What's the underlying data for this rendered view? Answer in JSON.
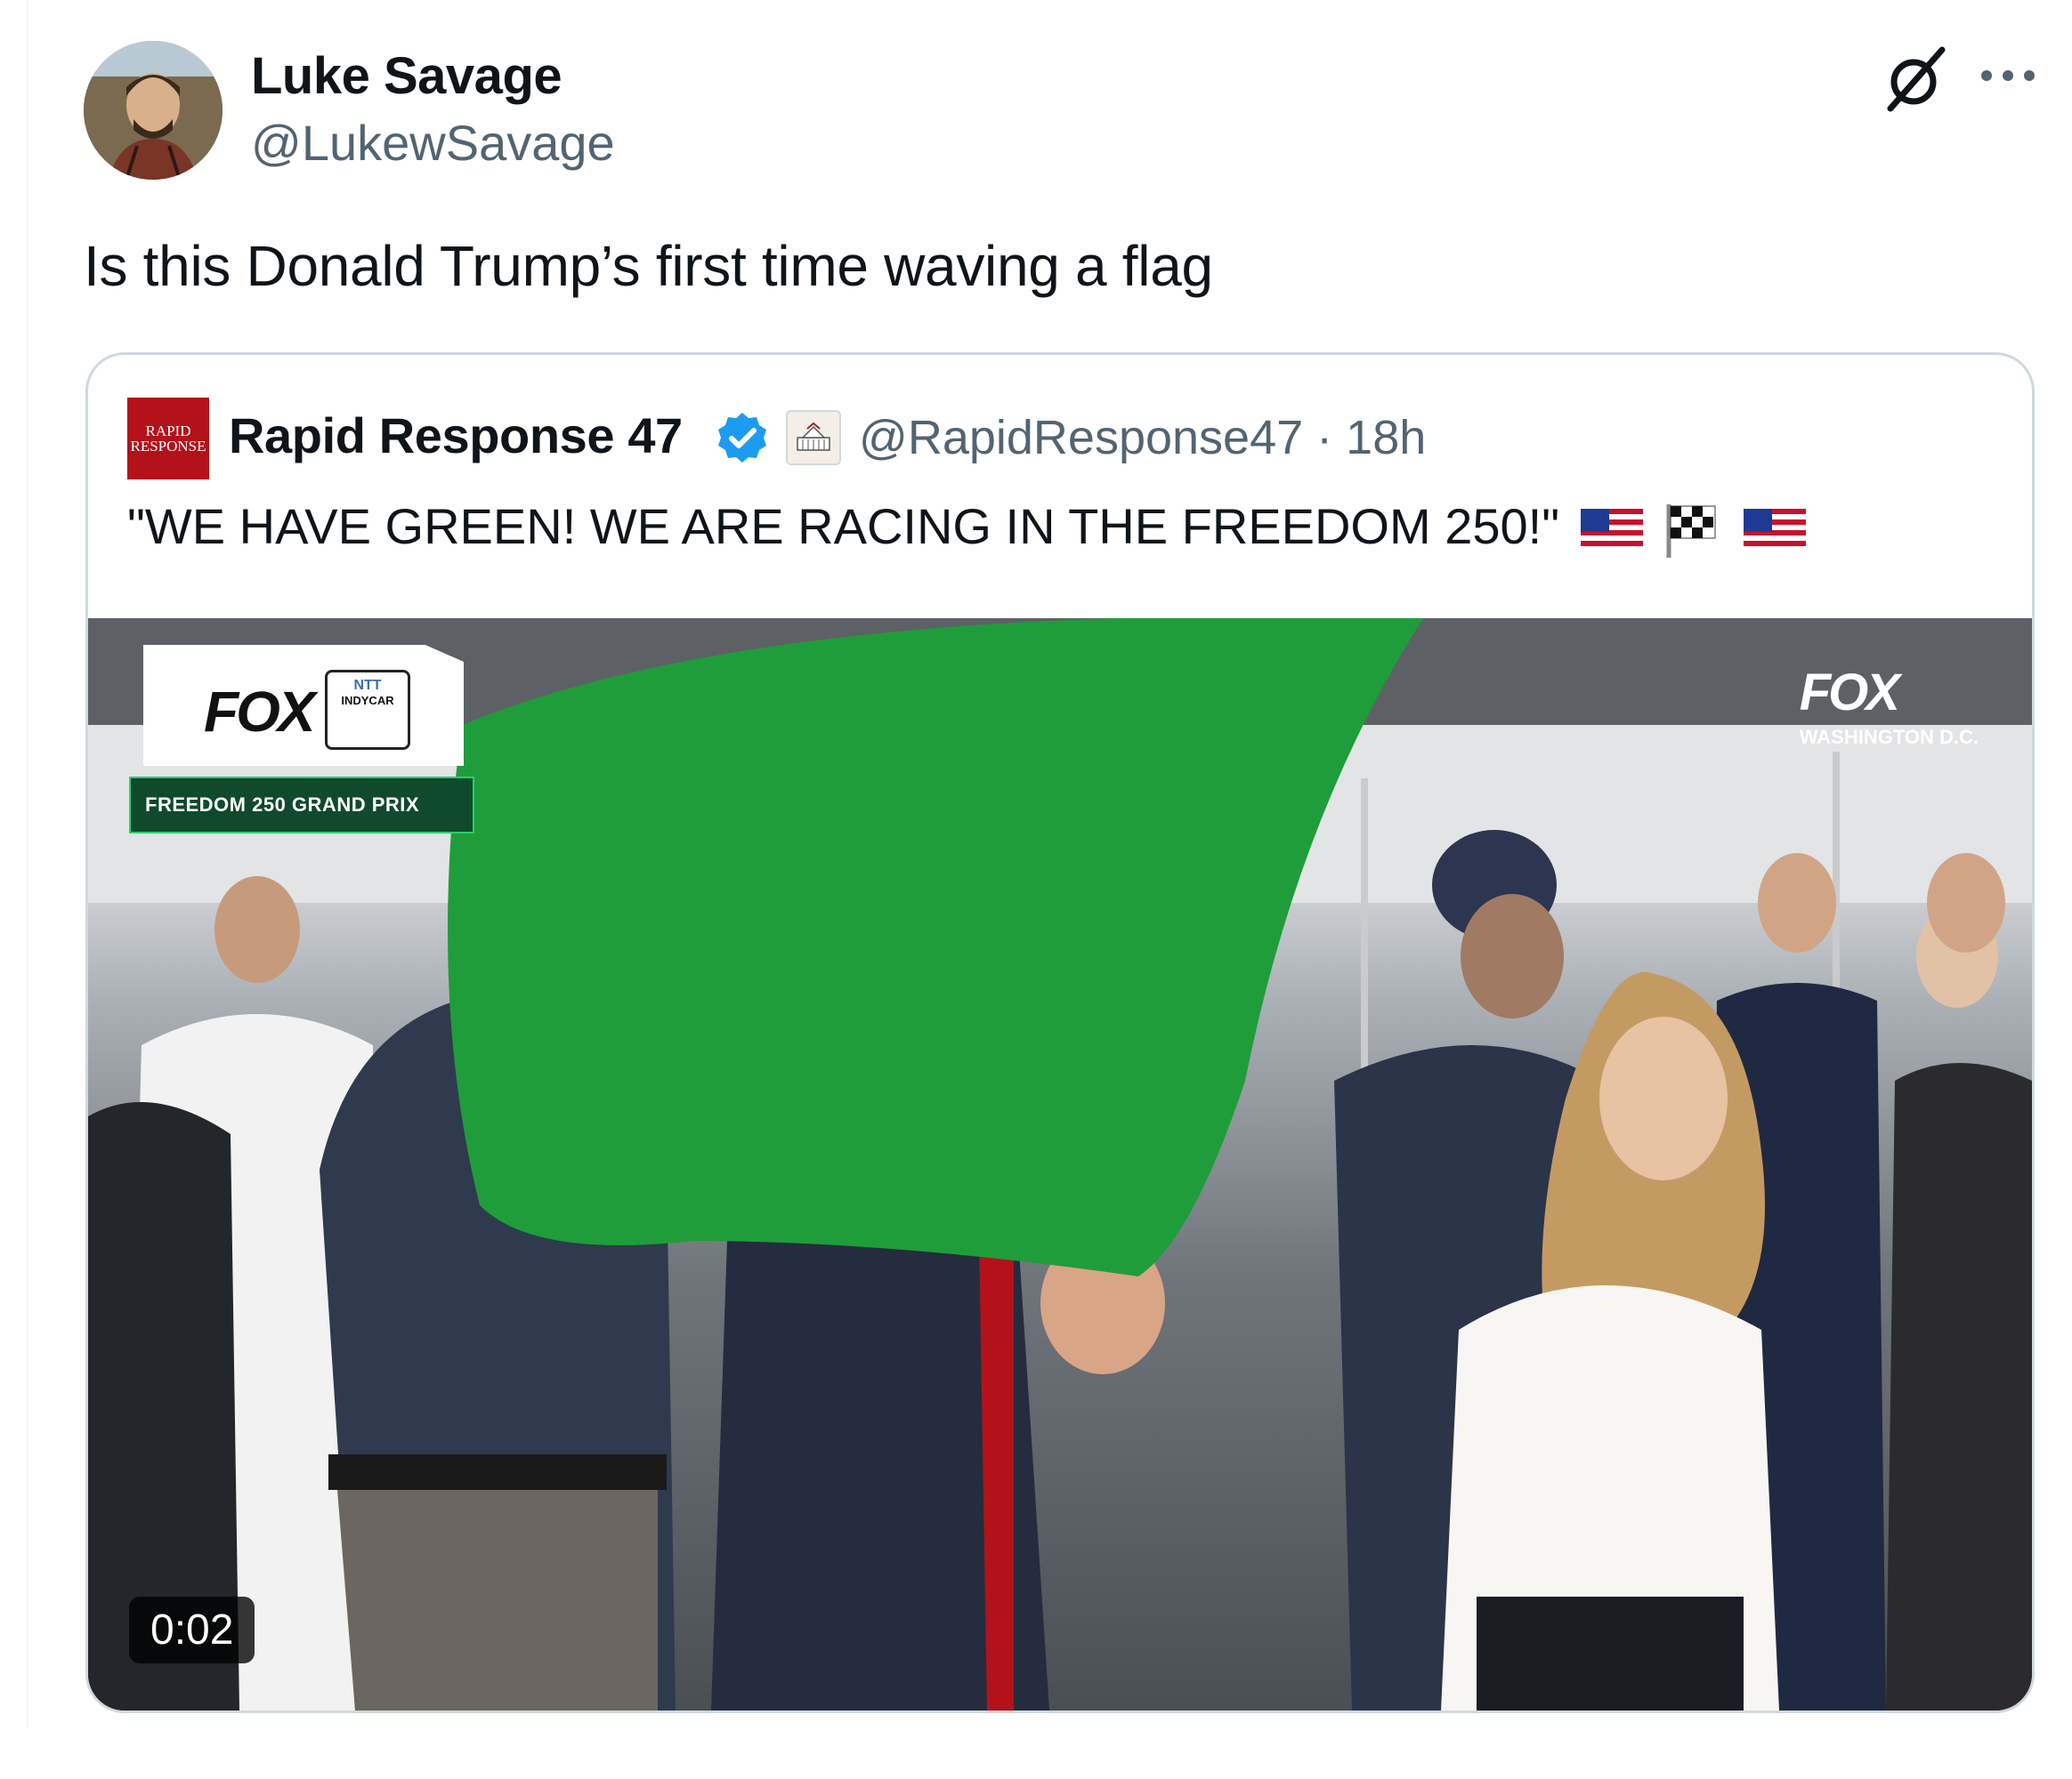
{
  "tweet": {
    "author_name": "Luke Savage",
    "author_handle": "@LukewSavage",
    "text": "Is this Donald Trump’s first time waving a flag"
  },
  "icons": {
    "grok": "grok-slash-icon",
    "more": "more-dots-icon",
    "verified": "verified-badge-icon",
    "affiliation": "white-house-affiliation-icon"
  },
  "quoted": {
    "author_name": "Rapid Response 47",
    "author_handle": "@RapidResponse47",
    "separator": "·",
    "time": "18h",
    "text": "\"WE HAVE GREEN! WE ARE RACING IN THE FREEDOM 250!\"",
    "emojis": [
      "us-flag",
      "checkered-flag",
      "us-flag"
    ],
    "avatar_text": [
      "RAPID",
      "RESPONSE"
    ]
  },
  "video": {
    "duration": "0:02",
    "overlay": {
      "network": "FOX",
      "series": "INDYCAR",
      "series_sponsor": "NTT",
      "event": "FREEDOM 250 GRAND PRIX",
      "corner_network": "FOX",
      "corner_location": "WASHINGTON D.C."
    }
  },
  "colors": {
    "text_primary": "#0f1419",
    "text_secondary": "#536471",
    "border": "#cfd9de",
    "verified_blue": "#1d9bf0",
    "brand_red": "#b3121b",
    "flag_green": "#1f9d3a"
  }
}
